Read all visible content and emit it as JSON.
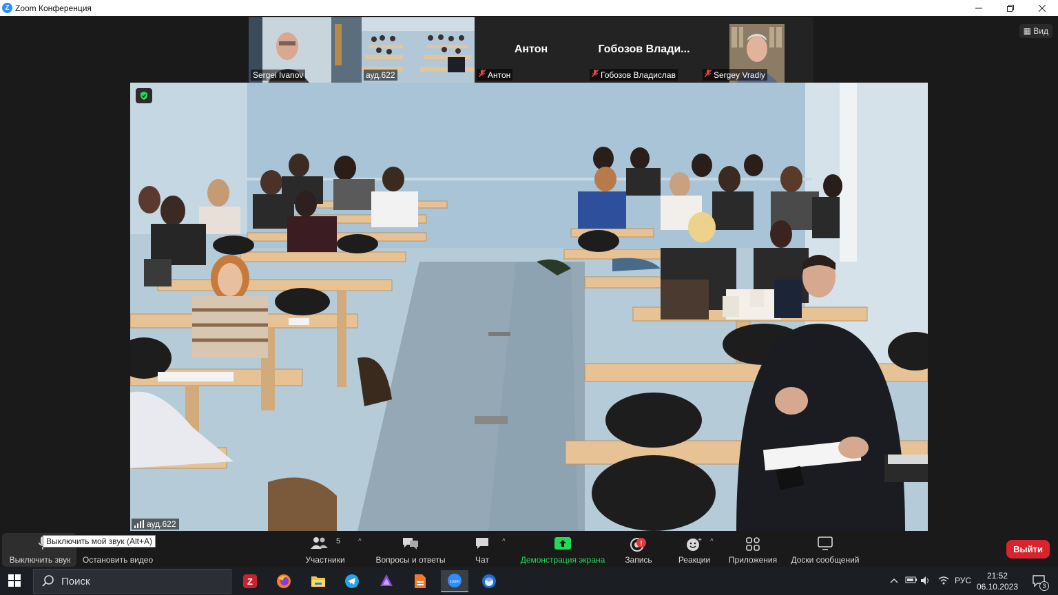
{
  "window": {
    "title": "Zoom Конференция",
    "logo_letter": "Z"
  },
  "view_button": "Вид",
  "participants_strip": [
    {
      "name_label": "Sergei Ivanov",
      "muted": false,
      "has_video": true
    },
    {
      "name_label": "ауд.622",
      "muted": false,
      "has_video": true,
      "active": true
    },
    {
      "display_name": "Антон",
      "name_label": "Антон",
      "muted": true,
      "has_video": false
    },
    {
      "display_name": "Гобозов Влади...",
      "name_label": "Гобозов Владислав",
      "muted": true,
      "has_video": false
    },
    {
      "name_label": "Sergey Vradiy",
      "muted": true,
      "has_video": true
    }
  ],
  "stage": {
    "label": "ауд.622"
  },
  "toolbar": {
    "mute_label": "Выключить звук",
    "mute_tooltip": "Выключить мой звук (Alt+A)",
    "video_label": "Остановить видео",
    "participants_label": "Участники",
    "participants_count": "5",
    "qa_label": "Вопросы и ответы",
    "chat_label": "Чат",
    "share_label": "Демонстрация экрана",
    "record_label": "Запись",
    "reactions_label": "Реакции",
    "apps_label": "Приложения",
    "whiteboards_label": "Доски сообщений",
    "leave_label": "Выйти"
  },
  "taskbar": {
    "search_placeholder": "Поиск",
    "language": "РУС",
    "time": "21:52",
    "date": "06.10.2023",
    "notifications": "3"
  },
  "colors": {
    "accent_green": "#23d959",
    "leave_red": "#d9242d",
    "zoom_blue": "#2d8cff",
    "active_outline": "#c8d86b"
  }
}
